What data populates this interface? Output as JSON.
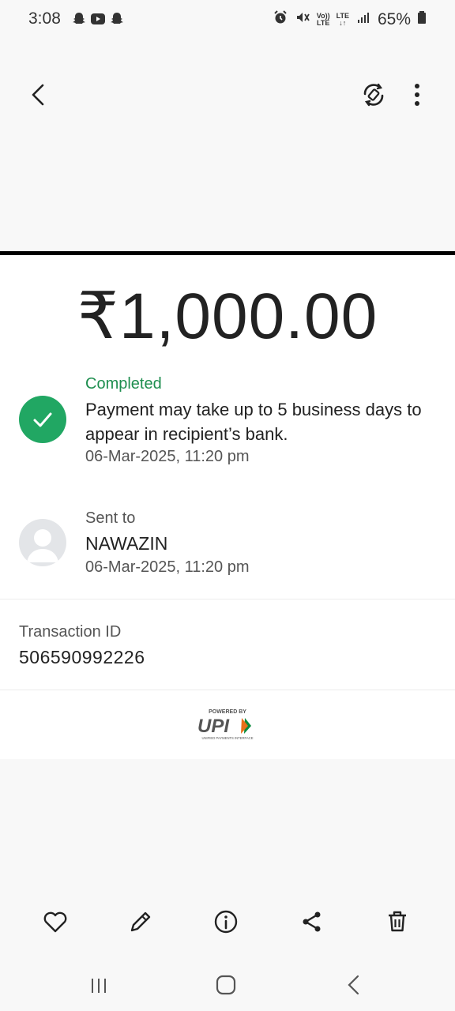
{
  "status_bar": {
    "time": "3:08",
    "battery": "65%",
    "volte": "Vo))",
    "lte": "LTE",
    "notification_icons": [
      "snapchat-icon",
      "youtube-icon",
      "snapchat-icon"
    ],
    "system_icons": [
      "alarm-icon",
      "mute-icon",
      "volte-icon",
      "lte-icon",
      "signal-icon",
      "battery-icon"
    ]
  },
  "app_bar": {
    "icons": [
      "back-arrow-icon",
      "rotate-icon",
      "more-vertical-icon"
    ]
  },
  "receipt": {
    "amount": "₹1,000.00",
    "status_label": "Completed",
    "status_message": "Payment may take up to 5 business days to appear in recipient’s bank.",
    "status_time": "06-Mar-2025, 11:20 pm",
    "sent_to_label": "Sent to",
    "recipient_name": "NAWAZIN",
    "sent_time": "06-Mar-2025, 11:20 pm",
    "transaction_id_label": "Transaction ID",
    "transaction_id": "506590992226",
    "upi": {
      "powered_by": "POWERED BY",
      "mark": "UPI",
      "tagline": "UNIFIED PAYMENTS INTERFACE"
    }
  },
  "colors": {
    "completed_green": "#21a763",
    "completed_text": "#1e8e4f",
    "upi_orange": "#e8701a",
    "upi_green": "#0b8a3c"
  },
  "action_bar": {
    "icons": [
      "heart-icon",
      "pencil-icon",
      "info-icon",
      "share-icon",
      "trash-icon"
    ]
  },
  "nav_bar": {
    "icons": [
      "recents-icon",
      "home-icon",
      "back-icon"
    ]
  }
}
